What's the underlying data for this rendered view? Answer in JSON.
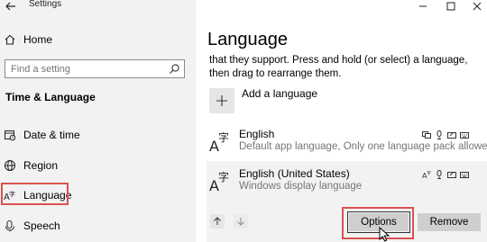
{
  "window": {
    "title": "Settings"
  },
  "sidebar": {
    "home_label": "Home",
    "search_placeholder": "Find a setting",
    "section_title": "Time & Language",
    "items": [
      {
        "label": "Date & time"
      },
      {
        "label": "Region"
      },
      {
        "label": "Language",
        "highlighted": true
      },
      {
        "label": "Speech"
      }
    ]
  },
  "main": {
    "title": "Language",
    "description": "that they support. Press and hold (or select) a language, then drag to rearrange them.",
    "add_language_label": "Add a language",
    "languages": [
      {
        "name": "English",
        "subtitle": "Default app language, Only one language pack allowed"
      },
      {
        "name": "English (United States)",
        "subtitle": "Windows display language",
        "selected": true
      }
    ],
    "buttons": {
      "options": "Options",
      "remove": "Remove"
    }
  },
  "colors": {
    "highlight": "#d9534f",
    "sidebar_bg": "#f2f2f2",
    "selected_row_bg": "#f2f2f2",
    "button_bg": "#cfcfcf"
  }
}
